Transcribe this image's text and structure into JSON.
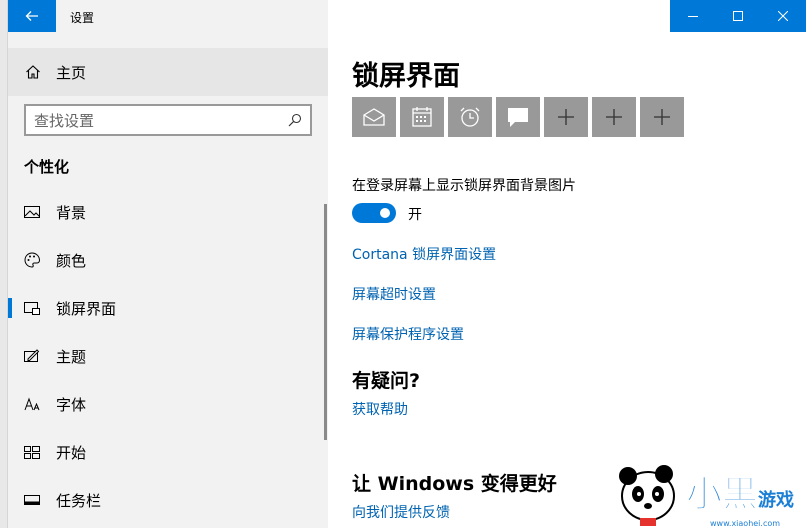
{
  "window": {
    "title": "设置"
  },
  "sidebar": {
    "home_label": "主页",
    "search_placeholder": "查找设置",
    "section_title": "个性化",
    "items": [
      {
        "label": "背景",
        "icon": "picture-icon"
      },
      {
        "label": "颜色",
        "icon": "palette-icon"
      },
      {
        "label": "锁屏界面",
        "icon": "lock-screen-icon",
        "selected": true
      },
      {
        "label": "主题",
        "icon": "theme-icon"
      },
      {
        "label": "字体",
        "icon": "font-icon"
      },
      {
        "label": "开始",
        "icon": "start-icon"
      },
      {
        "label": "任务栏",
        "icon": "taskbar-icon"
      }
    ]
  },
  "main": {
    "title": "锁屏界面",
    "quick_status_apps": [
      "mail-icon",
      "calendar-icon",
      "alarm-icon",
      "message-icon",
      "plus-icon",
      "plus-icon",
      "plus-icon"
    ],
    "show_background_label": "在登录屏幕上显示锁屏界面背景图片",
    "toggle_state": "开",
    "links": {
      "cortana": "Cortana 锁屏界面设置",
      "timeout": "屏幕超时设置",
      "screensaver": "屏幕保护程序设置"
    },
    "help": {
      "heading": "有疑问?",
      "link": "获取帮助"
    },
    "feedback": {
      "heading": "让 Windows 变得更好",
      "link": "向我们提供反馈"
    }
  },
  "watermark": {
    "text": "小黑游戏",
    "url": "www.xiaohei.com"
  },
  "colors": {
    "accent": "#0078d7",
    "link": "#0063b1",
    "tile": "#999999"
  }
}
